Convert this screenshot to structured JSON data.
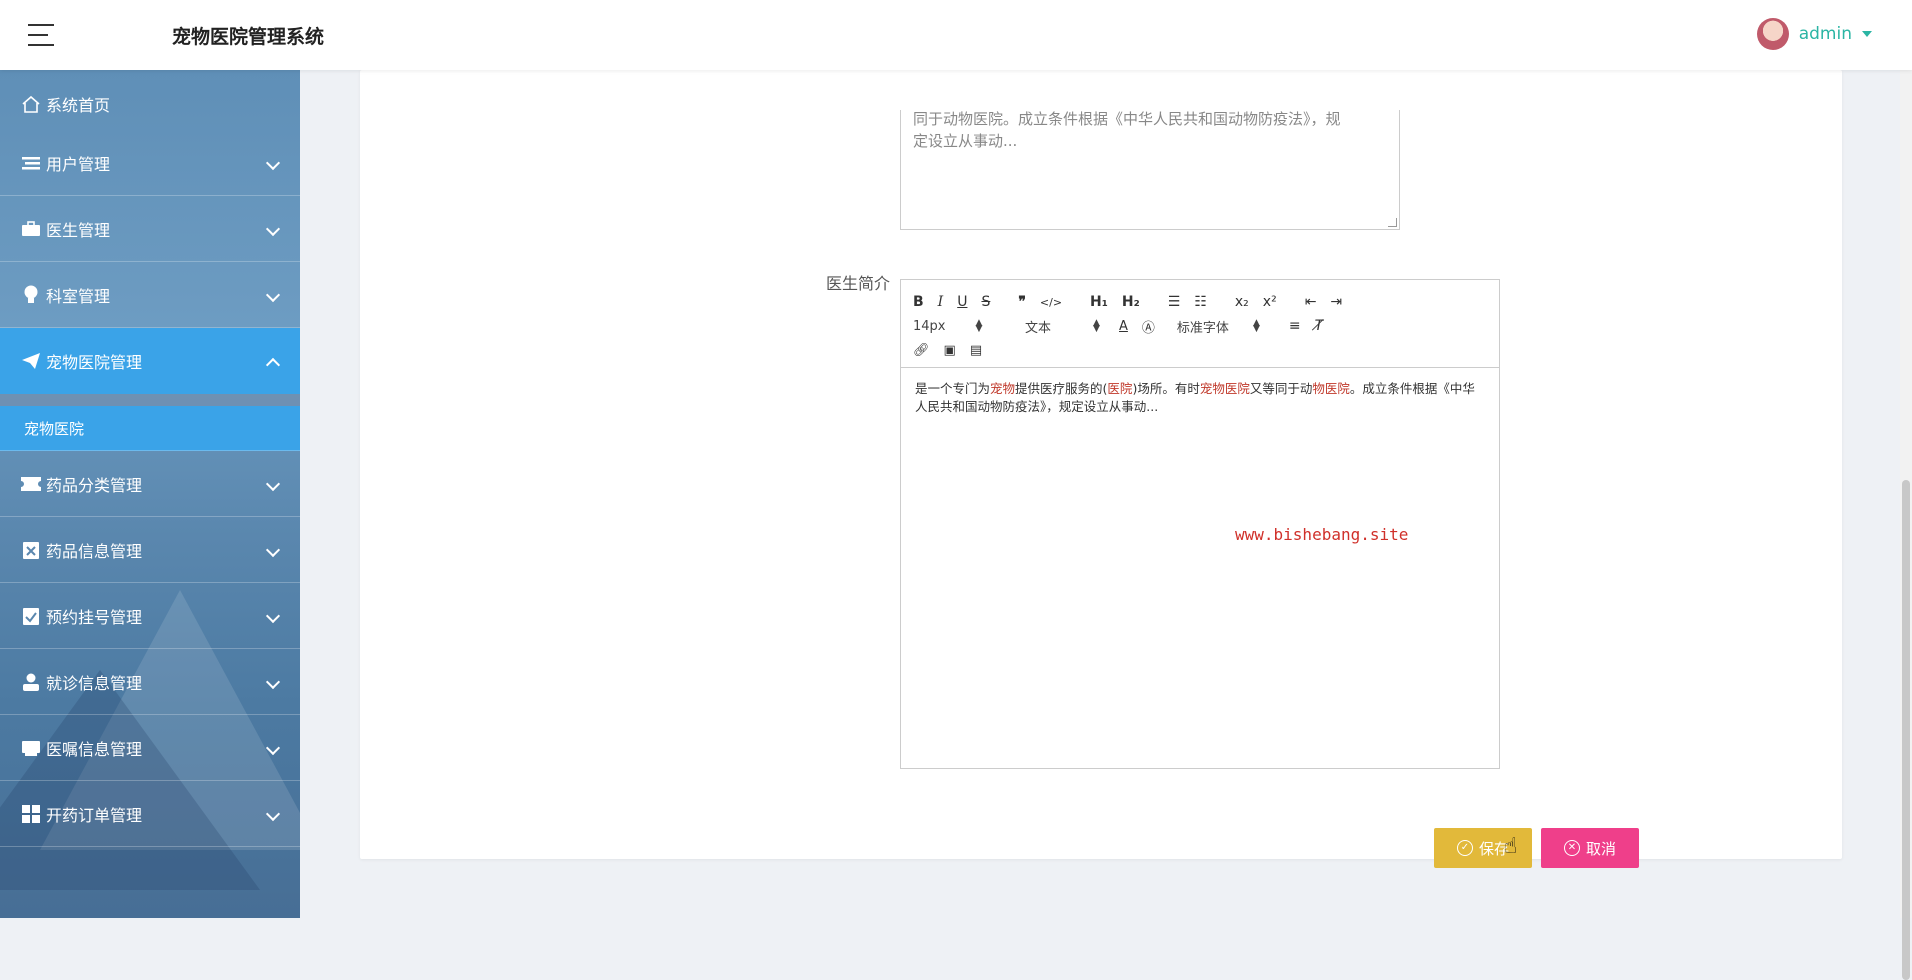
{
  "header": {
    "app_title": "宠物医院管理系统",
    "user_name": "admin"
  },
  "sidebar": {
    "home": "系统首页",
    "items": [
      {
        "label": "用户管理",
        "icon": "list-icon"
      },
      {
        "label": "医生管理",
        "icon": "briefcase-icon"
      },
      {
        "label": "科室管理",
        "icon": "bulb-icon"
      },
      {
        "label": "宠物医院管理",
        "icon": "paper-plane-icon",
        "active": true
      },
      {
        "label": "药品分类管理",
        "icon": "ticket-icon"
      },
      {
        "label": "药品信息管理",
        "icon": "clipboard-x-icon"
      },
      {
        "label": "预约挂号管理",
        "icon": "clipboard-check-icon"
      },
      {
        "label": "就诊信息管理",
        "icon": "person-icon"
      },
      {
        "label": "医嘱信息管理",
        "icon": "book-icon"
      },
      {
        "label": "开药订单管理",
        "icon": "grid-icon"
      }
    ],
    "submenu": [
      "宠物医院"
    ]
  },
  "form": {
    "prev_textarea_line1": "同于动物医院。成立条件根据《中华人民共和国动物防疫法》，规",
    "prev_textarea_line2": "定设立从事动...",
    "doctor_intro_label": "医生简介",
    "toolbar": {
      "font_size": "14px",
      "header_select": "文本",
      "font_family": "标准字体"
    },
    "editor_content": {
      "seg1": "是一个专门为",
      "kw1": "宠物",
      "seg2": "提供医疗服务的(",
      "kw2": "医院",
      "seg3": ")场所。有时",
      "kw3": "宠物医院",
      "seg4": "又等同于动",
      "kw4": "物医院",
      "seg5": "。成立条件根据《中华人民共和国动物防疫法》，规定设立从事动..."
    },
    "watermark": "www.bishebang.site",
    "save_label": "保存",
    "cancel_label": "取消"
  }
}
